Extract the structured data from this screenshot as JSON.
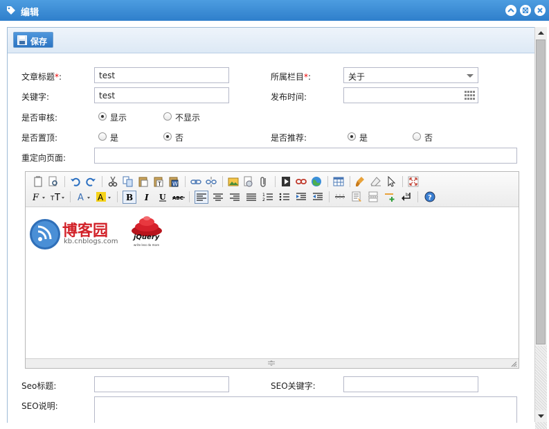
{
  "window": {
    "title": "编辑"
  },
  "toolbar": {
    "save_label": "保存"
  },
  "form": {
    "article_title": {
      "label": "文章标题",
      "required_mark": "*",
      "value": "test"
    },
    "category": {
      "label": "所属栏目",
      "required_mark": "*",
      "value": "关于"
    },
    "keywords": {
      "label": "关键字:",
      "value": "test"
    },
    "publish_time": {
      "label": "发布时间:",
      "value": ""
    },
    "review": {
      "label": "是否审核:",
      "options": [
        "显示",
        "不显示"
      ],
      "selected": "显示"
    },
    "pinned": {
      "label": "是否置顶:",
      "options": [
        "是",
        "否"
      ],
      "selected": "否"
    },
    "recommend": {
      "label": "是否推荐:",
      "options": [
        "是",
        "否"
      ],
      "selected": "是"
    },
    "redirect": {
      "label": "重定向页面:",
      "value": ""
    },
    "seo_title": {
      "label": "Seo标题:",
      "value": ""
    },
    "seo_keywords": {
      "label": "SEO关键字:",
      "value": ""
    },
    "seo_desc": {
      "label": "SEO说明:",
      "value": ""
    }
  },
  "editor": {
    "content_images": [
      {
        "name": "cnblogs-logo",
        "text": "博客园",
        "subtext": "kb.cnblogs.com"
      },
      {
        "name": "jquery-logo",
        "text": "jQuery",
        "subtext": "write less do more"
      }
    ],
    "toolbar_icons_row1": [
      "paste-word-icon",
      "preview-icon",
      "undo-icon",
      "redo-icon",
      "cut-icon",
      "copy-icon",
      "paste-icon",
      "paste-text-icon",
      "paste-word2-icon",
      "link-icon",
      "unlink-icon",
      "image-icon",
      "flash-icon",
      "attachment-icon",
      "media-icon",
      "iframe-link-icon",
      "map-icon",
      "table-icon",
      "clear-format-icon",
      "eraser-icon",
      "select-icon",
      "fullscreen-icon"
    ],
    "toolbar_icons_row2": [
      "font-family-icon",
      "font-size-icon",
      "font-color-icon",
      "highlight-color-icon",
      "bold-icon",
      "italic-icon",
      "underline-icon",
      "strikethrough-icon",
      "align-left-icon",
      "align-center-icon",
      "align-right-icon",
      "align-justify-icon",
      "ordered-list-icon",
      "unordered-list-icon",
      "indent-icon",
      "outdent-icon",
      "horizontal-rule-icon",
      "template-icon",
      "page-break-icon",
      "insert-row-icon",
      "line-break-icon",
      "help-icon"
    ]
  },
  "colors": {
    "titlebar": "#3a8bd6",
    "accent": "#2c74c2"
  }
}
